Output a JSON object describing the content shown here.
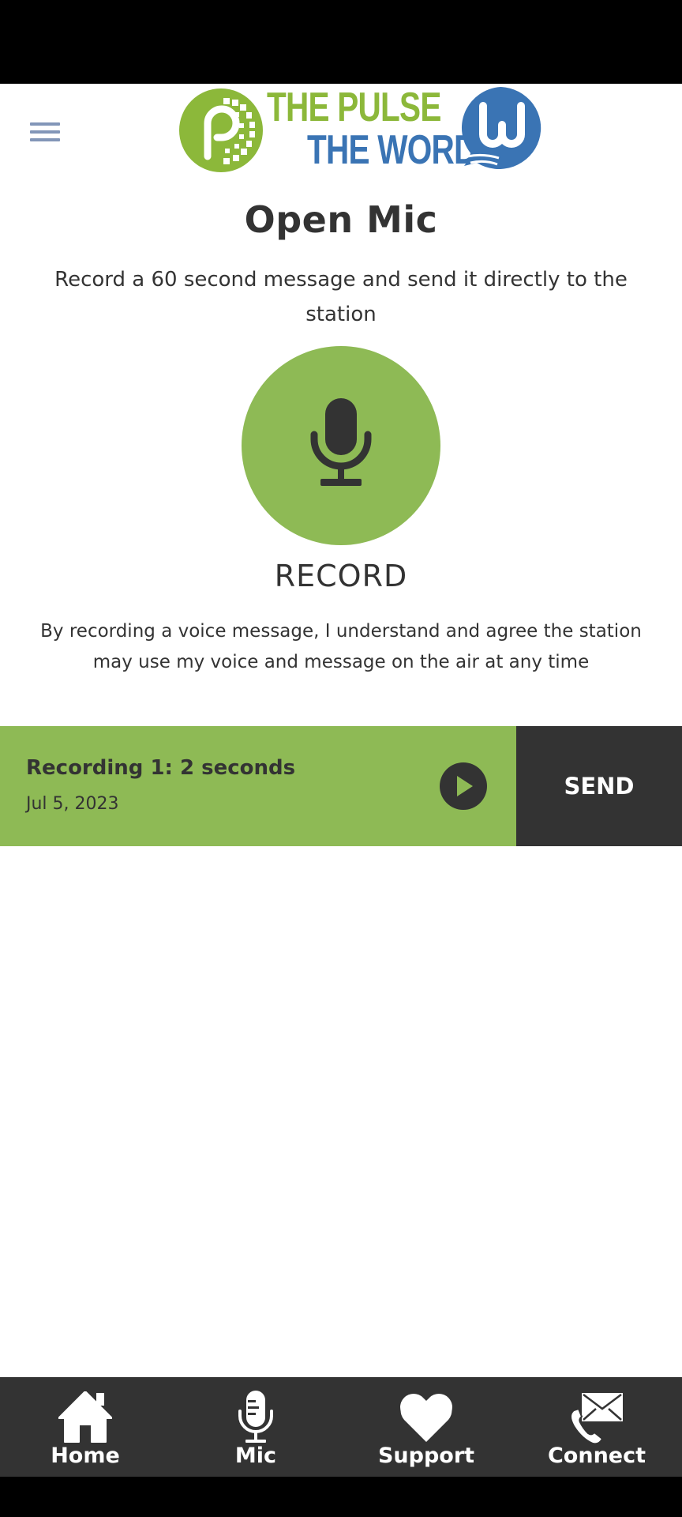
{
  "header": {
    "menu_icon": "hamburger-menu-icon",
    "logo": {
      "line1": "THE PULSE",
      "line2": "THE WORD",
      "p_badge_icon": "pulse-p-logo-icon",
      "w_badge_icon": "word-w-logo-icon",
      "colors": {
        "green": "#8cb83a",
        "blue": "#3a74b4"
      }
    }
  },
  "main": {
    "title": "Open Mic",
    "intro": "Record a 60 second message and send it directly to the station",
    "record_icon": "microphone-icon",
    "record_label": "RECORD",
    "disclaimer": "By recording a voice message, I understand and agree the station may use my voice and message on the air at any time"
  },
  "recordings": [
    {
      "title": "Recording 1: 2 seconds",
      "date": "Jul 5, 2023",
      "play_icon": "play-icon",
      "send_label": "SEND"
    }
  ],
  "nav": {
    "items": [
      {
        "label": "Home",
        "icon": "home-icon"
      },
      {
        "label": "Mic",
        "icon": "microphone-icon"
      },
      {
        "label": "Support",
        "icon": "heart-icon"
      },
      {
        "label": "Connect",
        "icon": "phone-mail-icon"
      }
    ]
  },
  "colors": {
    "accent_green": "#8eba55",
    "dark": "#333333",
    "menu_icon": "#8296b8"
  }
}
